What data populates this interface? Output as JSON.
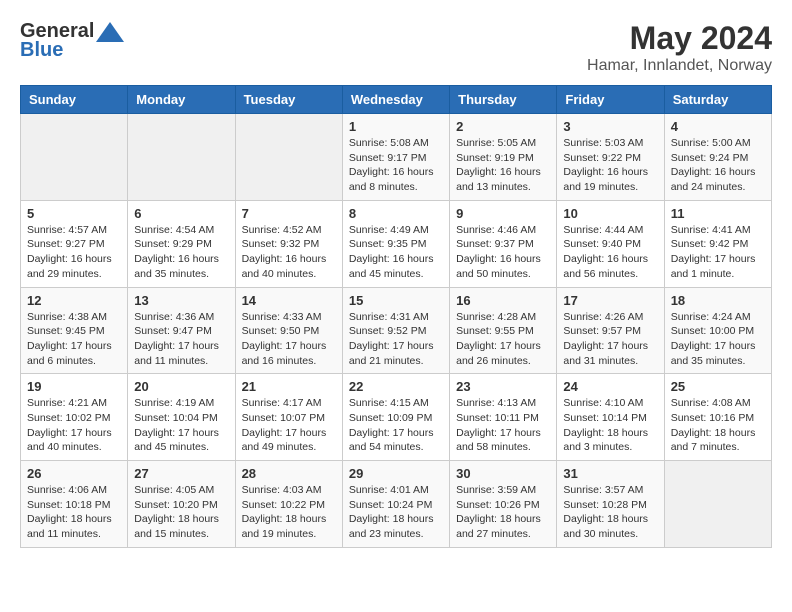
{
  "header": {
    "logo": {
      "general": "General",
      "blue": "Blue"
    },
    "title": "May 2024",
    "location": "Hamar, Innlandet, Norway"
  },
  "weekdays": [
    "Sunday",
    "Monday",
    "Tuesday",
    "Wednesday",
    "Thursday",
    "Friday",
    "Saturday"
  ],
  "weeks": [
    [
      {
        "day": "",
        "info": ""
      },
      {
        "day": "",
        "info": ""
      },
      {
        "day": "",
        "info": ""
      },
      {
        "day": "1",
        "info": "Sunrise: 5:08 AM\nSunset: 9:17 PM\nDaylight: 16 hours\nand 8 minutes."
      },
      {
        "day": "2",
        "info": "Sunrise: 5:05 AM\nSunset: 9:19 PM\nDaylight: 16 hours\nand 13 minutes."
      },
      {
        "day": "3",
        "info": "Sunrise: 5:03 AM\nSunset: 9:22 PM\nDaylight: 16 hours\nand 19 minutes."
      },
      {
        "day": "4",
        "info": "Sunrise: 5:00 AM\nSunset: 9:24 PM\nDaylight: 16 hours\nand 24 minutes."
      }
    ],
    [
      {
        "day": "5",
        "info": "Sunrise: 4:57 AM\nSunset: 9:27 PM\nDaylight: 16 hours\nand 29 minutes."
      },
      {
        "day": "6",
        "info": "Sunrise: 4:54 AM\nSunset: 9:29 PM\nDaylight: 16 hours\nand 35 minutes."
      },
      {
        "day": "7",
        "info": "Sunrise: 4:52 AM\nSunset: 9:32 PM\nDaylight: 16 hours\nand 40 minutes."
      },
      {
        "day": "8",
        "info": "Sunrise: 4:49 AM\nSunset: 9:35 PM\nDaylight: 16 hours\nand 45 minutes."
      },
      {
        "day": "9",
        "info": "Sunrise: 4:46 AM\nSunset: 9:37 PM\nDaylight: 16 hours\nand 50 minutes."
      },
      {
        "day": "10",
        "info": "Sunrise: 4:44 AM\nSunset: 9:40 PM\nDaylight: 16 hours\nand 56 minutes."
      },
      {
        "day": "11",
        "info": "Sunrise: 4:41 AM\nSunset: 9:42 PM\nDaylight: 17 hours\nand 1 minute."
      }
    ],
    [
      {
        "day": "12",
        "info": "Sunrise: 4:38 AM\nSunset: 9:45 PM\nDaylight: 17 hours\nand 6 minutes."
      },
      {
        "day": "13",
        "info": "Sunrise: 4:36 AM\nSunset: 9:47 PM\nDaylight: 17 hours\nand 11 minutes."
      },
      {
        "day": "14",
        "info": "Sunrise: 4:33 AM\nSunset: 9:50 PM\nDaylight: 17 hours\nand 16 minutes."
      },
      {
        "day": "15",
        "info": "Sunrise: 4:31 AM\nSunset: 9:52 PM\nDaylight: 17 hours\nand 21 minutes."
      },
      {
        "day": "16",
        "info": "Sunrise: 4:28 AM\nSunset: 9:55 PM\nDaylight: 17 hours\nand 26 minutes."
      },
      {
        "day": "17",
        "info": "Sunrise: 4:26 AM\nSunset: 9:57 PM\nDaylight: 17 hours\nand 31 minutes."
      },
      {
        "day": "18",
        "info": "Sunrise: 4:24 AM\nSunset: 10:00 PM\nDaylight: 17 hours\nand 35 minutes."
      }
    ],
    [
      {
        "day": "19",
        "info": "Sunrise: 4:21 AM\nSunset: 10:02 PM\nDaylight: 17 hours\nand 40 minutes."
      },
      {
        "day": "20",
        "info": "Sunrise: 4:19 AM\nSunset: 10:04 PM\nDaylight: 17 hours\nand 45 minutes."
      },
      {
        "day": "21",
        "info": "Sunrise: 4:17 AM\nSunset: 10:07 PM\nDaylight: 17 hours\nand 49 minutes."
      },
      {
        "day": "22",
        "info": "Sunrise: 4:15 AM\nSunset: 10:09 PM\nDaylight: 17 hours\nand 54 minutes."
      },
      {
        "day": "23",
        "info": "Sunrise: 4:13 AM\nSunset: 10:11 PM\nDaylight: 17 hours\nand 58 minutes."
      },
      {
        "day": "24",
        "info": "Sunrise: 4:10 AM\nSunset: 10:14 PM\nDaylight: 18 hours\nand 3 minutes."
      },
      {
        "day": "25",
        "info": "Sunrise: 4:08 AM\nSunset: 10:16 PM\nDaylight: 18 hours\nand 7 minutes."
      }
    ],
    [
      {
        "day": "26",
        "info": "Sunrise: 4:06 AM\nSunset: 10:18 PM\nDaylight: 18 hours\nand 11 minutes."
      },
      {
        "day": "27",
        "info": "Sunrise: 4:05 AM\nSunset: 10:20 PM\nDaylight: 18 hours\nand 15 minutes."
      },
      {
        "day": "28",
        "info": "Sunrise: 4:03 AM\nSunset: 10:22 PM\nDaylight: 18 hours\nand 19 minutes."
      },
      {
        "day": "29",
        "info": "Sunrise: 4:01 AM\nSunset: 10:24 PM\nDaylight: 18 hours\nand 23 minutes."
      },
      {
        "day": "30",
        "info": "Sunrise: 3:59 AM\nSunset: 10:26 PM\nDaylight: 18 hours\nand 27 minutes."
      },
      {
        "day": "31",
        "info": "Sunrise: 3:57 AM\nSunset: 10:28 PM\nDaylight: 18 hours\nand 30 minutes."
      },
      {
        "day": "",
        "info": ""
      }
    ]
  ]
}
